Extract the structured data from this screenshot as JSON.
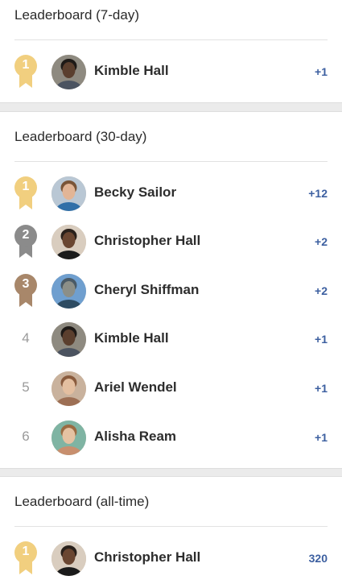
{
  "colors": {
    "gold": "#f1cf7f",
    "silver": "#8b8b8b",
    "bronze": "#a8876a",
    "score": "#3c5fa0"
  },
  "boards": [
    {
      "title": "Leaderboard (7-day)",
      "rows": [
        {
          "rank": "1",
          "medal": "gold",
          "name": "Kimble Hall",
          "score": "+1",
          "avatar": "kimble-avatar"
        }
      ]
    },
    {
      "title": "Leaderboard (30-day)",
      "rows": [
        {
          "rank": "1",
          "medal": "gold",
          "name": "Becky Sailor",
          "score": "+12",
          "avatar": "becky-avatar"
        },
        {
          "rank": "2",
          "medal": "silver",
          "name": "Christopher Hall",
          "score": "+2",
          "avatar": "christopher-avatar"
        },
        {
          "rank": "3",
          "medal": "bronze",
          "name": "Cheryl Shiffman",
          "score": "+2",
          "avatar": "cheryl-avatar"
        },
        {
          "rank": "4",
          "medal": "none",
          "name": "Kimble Hall",
          "score": "+1",
          "avatar": "kimble-avatar"
        },
        {
          "rank": "5",
          "medal": "none",
          "name": "Ariel Wendel",
          "score": "+1",
          "avatar": "ariel-avatar"
        },
        {
          "rank": "6",
          "medal": "none",
          "name": "Alisha Ream",
          "score": "+1",
          "avatar": "alisha-avatar"
        }
      ]
    },
    {
      "title": "Leaderboard (all-time)",
      "rows": [
        {
          "rank": "1",
          "medal": "gold",
          "name": "Christopher Hall",
          "score": "320",
          "avatar": "christopher-avatar"
        }
      ]
    }
  ]
}
